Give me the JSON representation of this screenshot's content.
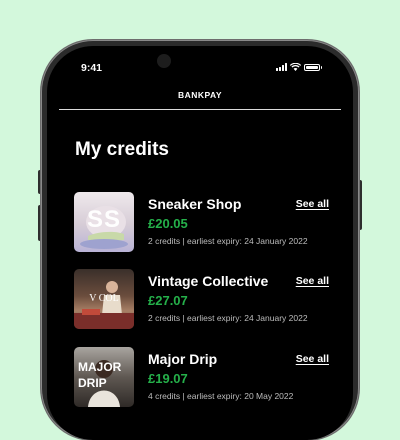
{
  "status_bar": {
    "time": "9:41",
    "icons": [
      "signal-icon",
      "wifi-icon",
      "battery-icon"
    ]
  },
  "brand": "BANKPAY",
  "page_title": "My credits",
  "colors": {
    "page_background": "#d3f8dc",
    "screen_background": "#000000",
    "amount_green": "#25b04a"
  },
  "credits": [
    {
      "name": "Sneaker Shop",
      "thumb_text": "SS",
      "amount": "£20.05",
      "meta": "2 credits | earliest expiry: 24 January 2022",
      "link": "See all"
    },
    {
      "name": "Vintage Collective",
      "thumb_text": "V COL",
      "amount": "£27.07",
      "meta": "2 credits | earliest expiry: 24 January 2022",
      "link": "See all"
    },
    {
      "name": "Major Drip",
      "thumb_text": "MAJOR DRIP",
      "amount": "£19.07",
      "meta": "4 credits | earliest expiry: 20 May 2022",
      "link": "See all"
    }
  ]
}
